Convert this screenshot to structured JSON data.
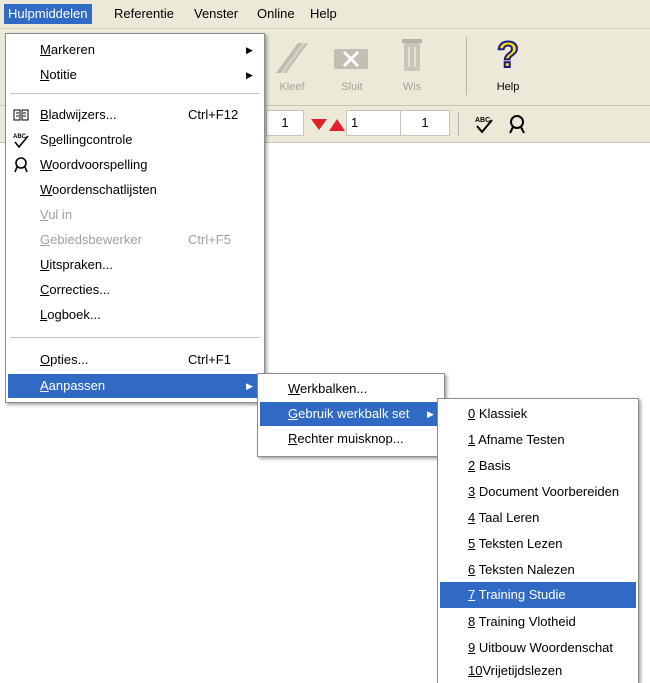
{
  "menubar": {
    "items": [
      {
        "label": "Hulpmiddelen"
      },
      {
        "label": "Referentie"
      },
      {
        "label": "Venster"
      },
      {
        "label": "Online"
      },
      {
        "label": "Help"
      }
    ]
  },
  "toolbar": {
    "kleef_label": "Kleef",
    "sluit_label": "Sluit",
    "wis_label": "Wis",
    "help_label": "Help",
    "page_value_1": "1",
    "page_value_2": "1",
    "page_value_3": "1"
  },
  "tools_menu": {
    "items": [
      {
        "label": "Markeren",
        "ul": "M",
        "rest": "arkeren",
        "submenu": true
      },
      {
        "label": "Notitie",
        "ul": "N",
        "rest": "otitie",
        "submenu": true
      },
      {
        "label": "Bladwijzers...",
        "ul": "B",
        "rest": "ladwijzers...",
        "shortcut": "Ctrl+F12",
        "icon": "book-icon"
      },
      {
        "label": "Spellingcontrole",
        "pre": "S",
        "ul": "p",
        "rest": "ellingcontrole",
        "icon": "spellcheck-icon"
      },
      {
        "label": "Woordvoorspelling",
        "ul": "W",
        "rest": "oordvoorspelling",
        "icon": "magnifier-icon"
      },
      {
        "label": "Woordenschatlijsten",
        "ul": "W",
        "rest": "oordenschatlijsten"
      },
      {
        "label": "Vul in",
        "ul": "V",
        "rest": "ul in",
        "disabled": true
      },
      {
        "label": "Gebiedsbewerker",
        "ul": "G",
        "rest": "ebiedsbewerker",
        "shortcut": "Ctrl+F5",
        "disabled": true
      },
      {
        "label": "Uitspraken...",
        "ul": "U",
        "rest": "itspraken..."
      },
      {
        "label": "Correcties...",
        "ul": "C",
        "rest": "orrecties..."
      },
      {
        "label": "Logboek...",
        "ul": "L",
        "rest": "ogboek..."
      },
      {
        "label": "Opties...",
        "ul": "O",
        "rest": "pties...",
        "shortcut": "Ctrl+F1"
      },
      {
        "label": "Aanpassen",
        "ul": "A",
        "rest": "anpassen",
        "submenu": true,
        "selected": true
      }
    ]
  },
  "customize_menu": {
    "items": [
      {
        "label": "Werkbalken...",
        "ul": "W",
        "rest": "erkbalken..."
      },
      {
        "label": "Gebruik werkbalk set",
        "ul": "G",
        "rest": "ebruik werkbalk set",
        "submenu": true,
        "selected": true
      },
      {
        "label": "Rechter muisknop...",
        "ul": "R",
        "rest": "echter muisknop..."
      }
    ]
  },
  "toolbar_sets_menu": {
    "items": [
      {
        "num": "0",
        "label": "Klassiek"
      },
      {
        "num": "1",
        "label": "Afname Testen"
      },
      {
        "num": "2",
        "label": "Basis"
      },
      {
        "num": "3",
        "label": "Document Voorbereiden"
      },
      {
        "num": "4",
        "label": "Taal Leren"
      },
      {
        "num": "5",
        "label": "Teksten Lezen"
      },
      {
        "num": "6",
        "label": "Teksten Nalezen"
      },
      {
        "num": "7",
        "label": "Training Studie",
        "selected": true
      },
      {
        "num": "8",
        "label": "Training Vlotheid"
      },
      {
        "num": "9",
        "label": "Uitbouw Woordenschat"
      },
      {
        "num": "10",
        "label": "Vrijetijdslezen"
      }
    ]
  },
  "colors": {
    "highlight": "#316ac5",
    "chrome": "#ece9d8",
    "disabled_text": "#a0a0a0"
  }
}
